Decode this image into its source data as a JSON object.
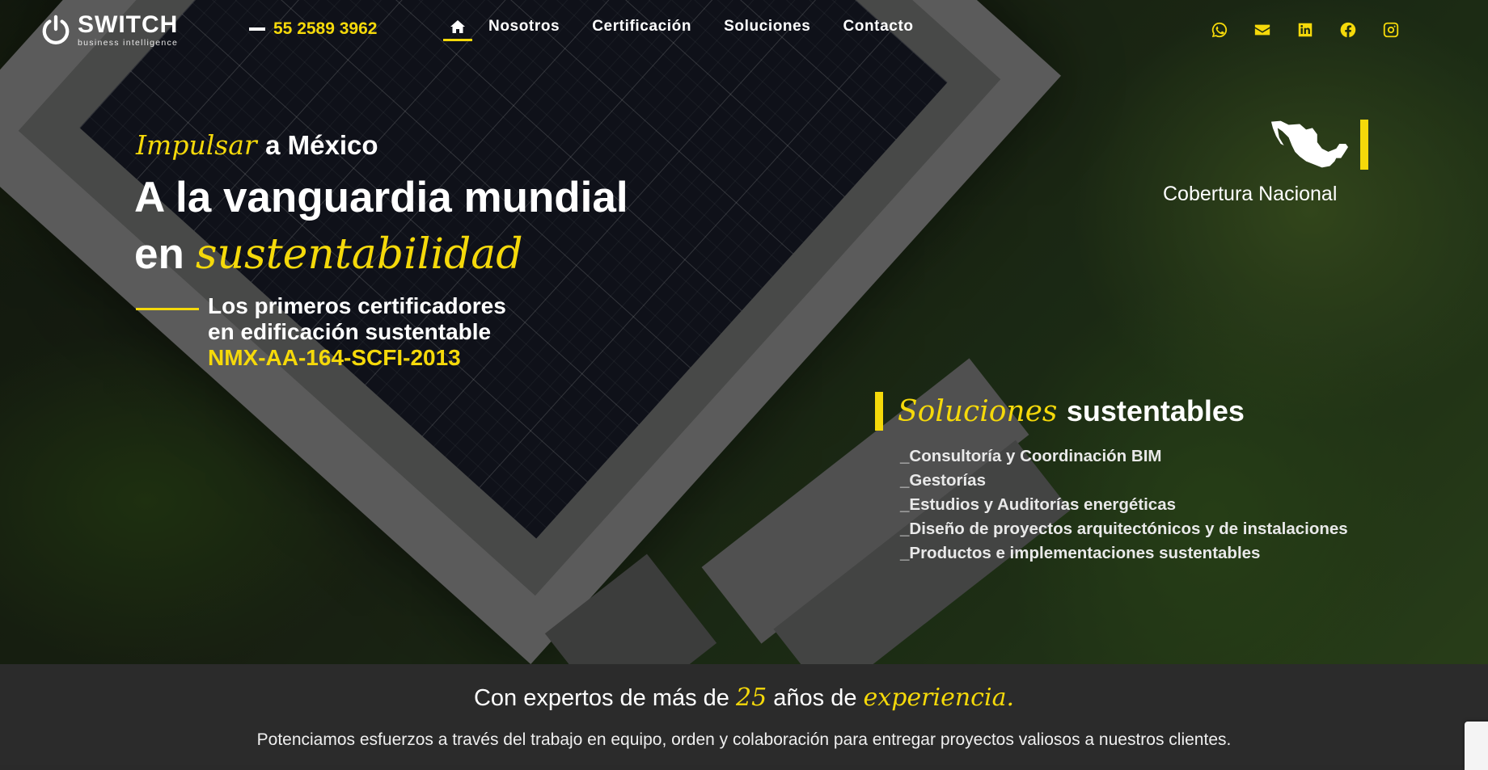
{
  "brand": {
    "name": "SWITCH",
    "tagline": "business intelligence"
  },
  "header": {
    "phone": "55 2589 3962",
    "nav": [
      {
        "label": "Nosotros"
      },
      {
        "label": "Certificación"
      },
      {
        "label": "Soluciones"
      },
      {
        "label": "Contacto"
      }
    ],
    "home_icon": "home-icon",
    "social_icons": [
      "whatsapp-icon",
      "envelope-icon",
      "linkedin-icon",
      "facebook-icon",
      "instagram-icon"
    ]
  },
  "hero": {
    "kicker_script": "Impulsar",
    "kicker_rest": "a México",
    "title_line1": "A la vanguardia mundial",
    "title_line2_prefix": "en",
    "title_line2_script": "sustentabilidad",
    "claim_line1": "Los primeros certificadores",
    "claim_line2": "en edificación sustentable",
    "claim_norm": "NMX-AA-164-SCFI-2013",
    "coverage_label": "Cobertura Nacional",
    "solutions_script": "Soluciones",
    "solutions_bold": "sustentables",
    "solutions": [
      "_Consultoría y Coordinación BIM",
      "_Gestorías",
      "_Estudios y Auditorías energéticas",
      "_Diseño de proyectos arquitectónicos y de instalaciones",
      "_Productos e implementaciones sustentables"
    ]
  },
  "band": {
    "head_pre": "Con expertos de más de",
    "head_years": "25",
    "head_mid": "años de",
    "head_script": "experiencia.",
    "sub": "Potenciamos esfuerzos a través del trabajo en equipo, orden y colaboración para entregar proyectos valiosos a nuestros clientes."
  },
  "colors": {
    "accent": "#f5d90a",
    "band": "#2b2b2b",
    "text": "#ffffff"
  }
}
